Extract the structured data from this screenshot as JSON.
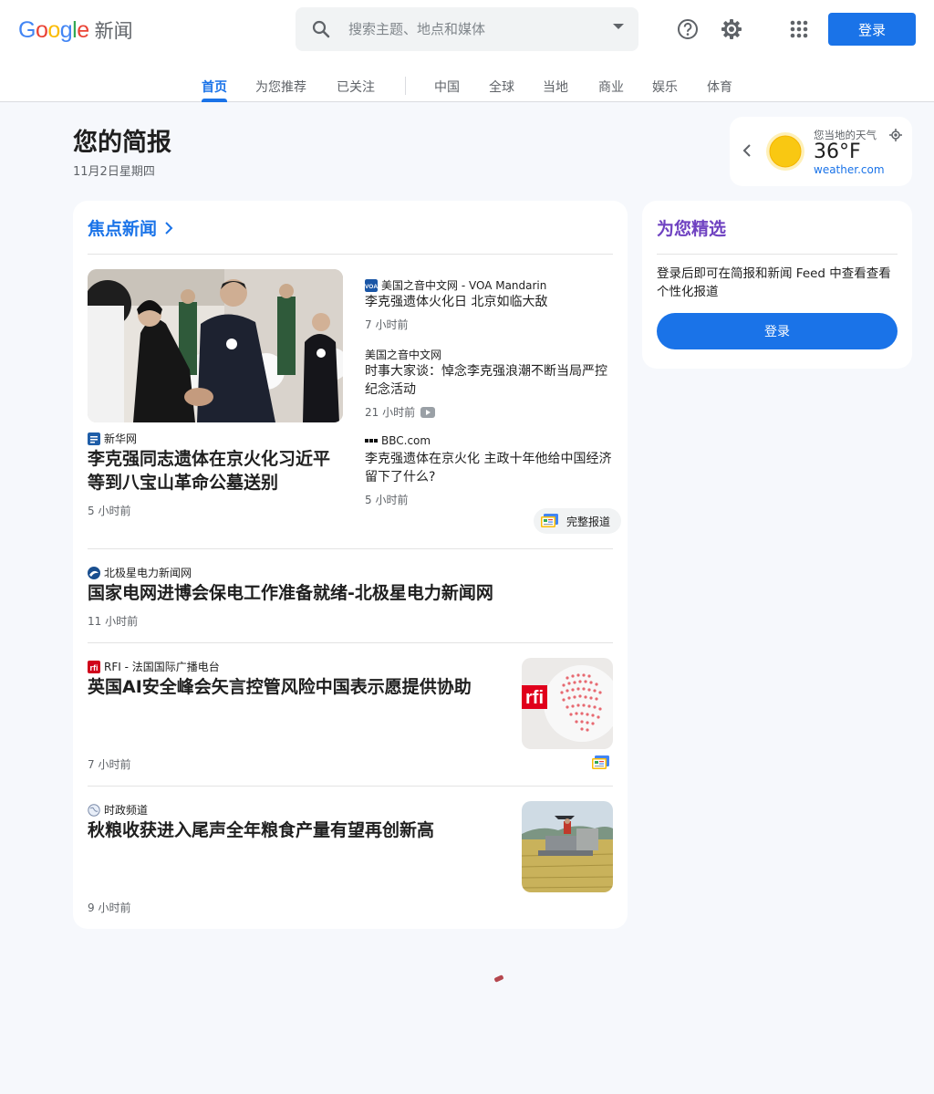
{
  "header": {
    "logo_word": "Google",
    "logo_product": "新闻",
    "search_placeholder": "搜索主题、地点和媒体",
    "signin_label": "登录"
  },
  "tabs": [
    {
      "label": "首页",
      "active": true
    },
    {
      "label": "为您推荐"
    },
    {
      "label": "已关注"
    },
    {
      "label": "中国"
    },
    {
      "label": "全球"
    },
    {
      "label": "当地"
    },
    {
      "label": "商业"
    },
    {
      "label": "娱乐"
    },
    {
      "label": "体育"
    }
  ],
  "briefing": {
    "title": "您的简报",
    "date": "11月2日星期四"
  },
  "weather": {
    "label": "您当地的天气",
    "temp": "36°F",
    "source": "weather.com"
  },
  "top_stories": {
    "title": "焦点新闻",
    "hero": {
      "source": "新华网",
      "headline": "李克强同志遗体在京火化习近平等到八宝山革命公墓送别",
      "time": "5 小时前"
    },
    "related": [
      {
        "source": "美国之音中文网 - VOA Mandarin",
        "headline": "李克强遗体火化日 北京如临大敌",
        "time": "7 小时前"
      },
      {
        "source": "美国之音中文网",
        "headline": "时事大家谈：悼念李克强浪潮不断当局严控纪念活动",
        "time": "21 小时前"
      },
      {
        "source": "BBC.com",
        "headline": "李克强遗体在京火化 主政十年他给中国经济留下了什么?",
        "time": "5 小时前"
      }
    ],
    "full_coverage": "完整报道"
  },
  "stories": [
    {
      "source": "北极星电力新闻网",
      "headline": "国家电网进博会保电工作准备就绪-北极星电力新闻网",
      "time": "11 小时前"
    },
    {
      "source": "RFI - 法国国际广播电台",
      "headline": "英国AI安全峰会矢言控管风险中国表示愿提供协助",
      "time": "7 小时前",
      "thumb_text": "rfi"
    },
    {
      "source": "时政频道",
      "headline": "秋粮收获进入尾声全年粮食产量有望再创新高",
      "time": "9 小时前"
    }
  ],
  "for_you": {
    "title": "为您精选",
    "text": "登录后即可在简报和新闻 Feed 中查看查看个性化报道",
    "button": "登录"
  },
  "colors": {
    "accent": "#1a73e8",
    "purple": "#6f42c1"
  }
}
